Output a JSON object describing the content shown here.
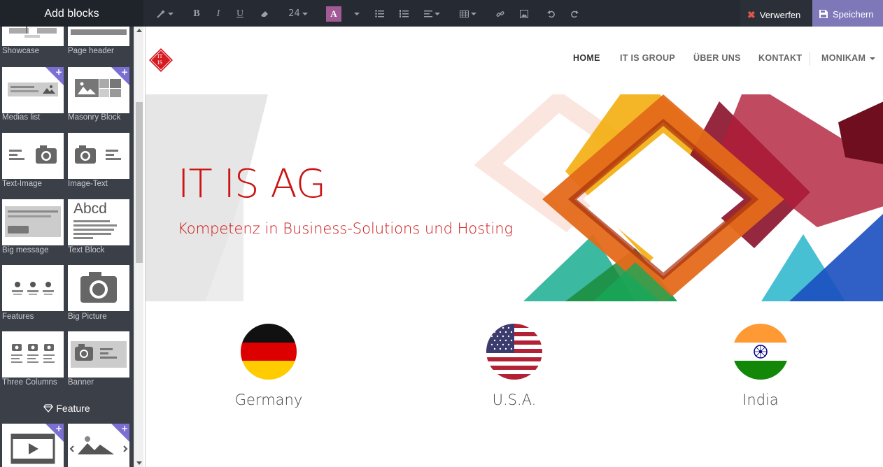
{
  "toolbar": {
    "sidebar_title": "Add blocks",
    "font_size": "24",
    "color_button": "A",
    "discard_label": "Verwerfen",
    "save_label": "Speichern",
    "save_color": "#7e78b9"
  },
  "sidebar": {
    "blocks": [
      {
        "label": "Showcase",
        "icon": "showcase-thumb-icon"
      },
      {
        "label": "Page header",
        "icon": "page-header-thumb-icon"
      },
      {
        "label": "Medias list",
        "icon": "medias-list-thumb-icon",
        "new": true
      },
      {
        "label": "Masonry Block",
        "icon": "masonry-thumb-icon",
        "new": true
      },
      {
        "label": "Text-Image",
        "icon": "text-image-thumb-icon"
      },
      {
        "label": "Image-Text",
        "icon": "image-text-thumb-icon"
      },
      {
        "label": "Big message",
        "icon": "big-message-thumb-icon"
      },
      {
        "label": "Text Block",
        "icon": "text-block-thumb-icon"
      },
      {
        "label": "Features",
        "icon": "features-thumb-icon"
      },
      {
        "label": "Big Picture",
        "icon": "big-picture-thumb-icon"
      },
      {
        "label": "Three Columns",
        "icon": "three-columns-thumb-icon"
      },
      {
        "label": "Banner",
        "icon": "banner-thumb-icon"
      }
    ],
    "text_block_sample": "Abcd",
    "feature_heading": "Feature",
    "feature_blocks": [
      {
        "icon": "video-thumb-icon",
        "new": true
      },
      {
        "icon": "image-gallery-thumb-icon",
        "new": true
      }
    ]
  },
  "site": {
    "logo_text_top": "IT",
    "logo_text_bottom": "IS",
    "nav": [
      "HOME",
      "IT IS GROUP",
      "ÜBER UNS",
      "KONTAKT"
    ],
    "user_menu": "MONIKAM",
    "hero_title": "IT IS AG",
    "hero_subtitle": "Kompetenz in Business-Solutions und Hosting",
    "brand_color": "#cc1414",
    "countries": [
      {
        "label": "Germany",
        "flag": "germany-flag-icon"
      },
      {
        "label": "U.S.A.",
        "flag": "usa-flag-icon"
      },
      {
        "label": "India",
        "flag": "india-flag-icon"
      }
    ]
  }
}
